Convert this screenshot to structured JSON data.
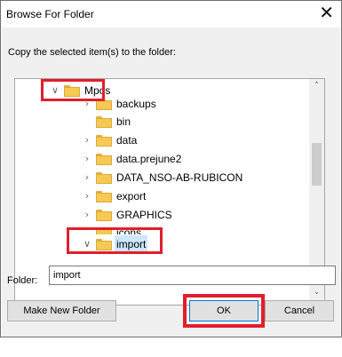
{
  "dialog": {
    "title": "Browse For Folder",
    "close_glyph": "✕",
    "instruction": "Copy the selected item(s) to the folder:"
  },
  "tree": {
    "items": [
      {
        "label": "Mpos",
        "expanded": true,
        "chevron": "∨",
        "highlighted": true
      },
      {
        "label": "backups",
        "expanded": false,
        "chevron": "›"
      },
      {
        "label": "bin",
        "expanded": false,
        "chevron": ""
      },
      {
        "label": "data",
        "expanded": false,
        "chevron": "›"
      },
      {
        "label": "data.prejune2",
        "expanded": false,
        "chevron": "›"
      },
      {
        "label": "DATA_NSO-AB-RUBICON",
        "expanded": false,
        "chevron": "›"
      },
      {
        "label": "export",
        "expanded": false,
        "chevron": "›"
      },
      {
        "label": "GRAPHICS",
        "expanded": false,
        "chevron": "›"
      },
      {
        "label": "icons",
        "expanded": false,
        "chevron": ""
      },
      {
        "label": "import",
        "expanded": true,
        "chevron": "∨",
        "highlighted": true,
        "selected": true
      }
    ],
    "scroll_up_glyph": "˄",
    "scroll_down_glyph": "˅"
  },
  "folder_field": {
    "label": "Folder:",
    "value": "import"
  },
  "buttons": {
    "make_new_folder": "Make New Folder",
    "ok": "OK",
    "cancel": "Cancel"
  },
  "colors": {
    "highlight_box": "#e21e2b",
    "selection": "#cce8ff",
    "folder": "#f6c952"
  }
}
